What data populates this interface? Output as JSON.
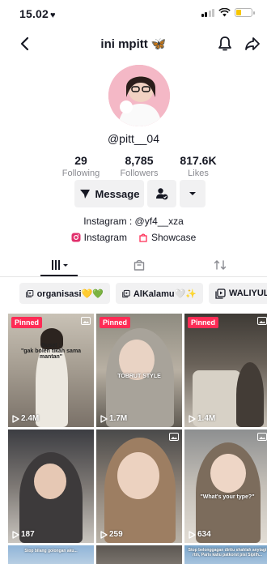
{
  "status_bar": {
    "time": "15.02",
    "heart": "♥",
    "battery_level": 0.35,
    "battery_color": "#f7c600"
  },
  "nav": {
    "title": "ini mpitt",
    "title_emoji": "🦋",
    "back_icon": "chevron-left-icon",
    "bell_icon": "bell-icon",
    "share_icon": "share-arrow-icon"
  },
  "profile": {
    "username": "@pitt__04",
    "stats": [
      {
        "value": "29",
        "label": "Following"
      },
      {
        "value": "8,785",
        "label": "Followers"
      },
      {
        "value": "817.6K",
        "label": "Likes"
      }
    ],
    "message_label": "Message",
    "bio": "Instagram : @yf4__xza",
    "links": [
      {
        "icon": "instagram-icon",
        "label": "Instagram"
      },
      {
        "icon": "shop-bag-icon",
        "label": "Showcase"
      }
    ]
  },
  "colors": {
    "accent": "#fe2c55",
    "text": "#161823",
    "muted": "#8a8b91",
    "button_bg": "#f1f1f2"
  },
  "playlists": [
    {
      "label": "organisasi💛💚"
    },
    {
      "label": "AlKalamu🤍✨"
    },
    {
      "label": "WALIYULL"
    }
  ],
  "videos": [
    {
      "pinned": "Pinned",
      "views": "2.4M",
      "caption": "Buset :\n\"gak boleh tikah sama mantan\""
    },
    {
      "pinned": "Pinned",
      "views": "1.7M",
      "caption": "TOBRUT STYLE"
    },
    {
      "pinned": "Pinned",
      "views": "1.4M",
      "caption": ""
    },
    {
      "pinned": "",
      "views": "187",
      "caption": ""
    },
    {
      "pinned": "",
      "views": "259",
      "caption": ""
    },
    {
      "pinned": "",
      "views": "634",
      "caption": "\"What's your type?\""
    },
    {
      "pinned": "",
      "views": "",
      "caption": "Stop bilang golongan aku..."
    },
    {
      "pinned": "",
      "views": "",
      "caption": ""
    },
    {
      "pinned": "",
      "views": "",
      "caption": "Stop belonggagan diritu shahlah anytagi rtin, Paris kaliu patkorst pisi Sipilh..."
    }
  ],
  "tab_icons": [
    "grid-icon",
    "shop-bag-icon",
    "repost-icon"
  ]
}
